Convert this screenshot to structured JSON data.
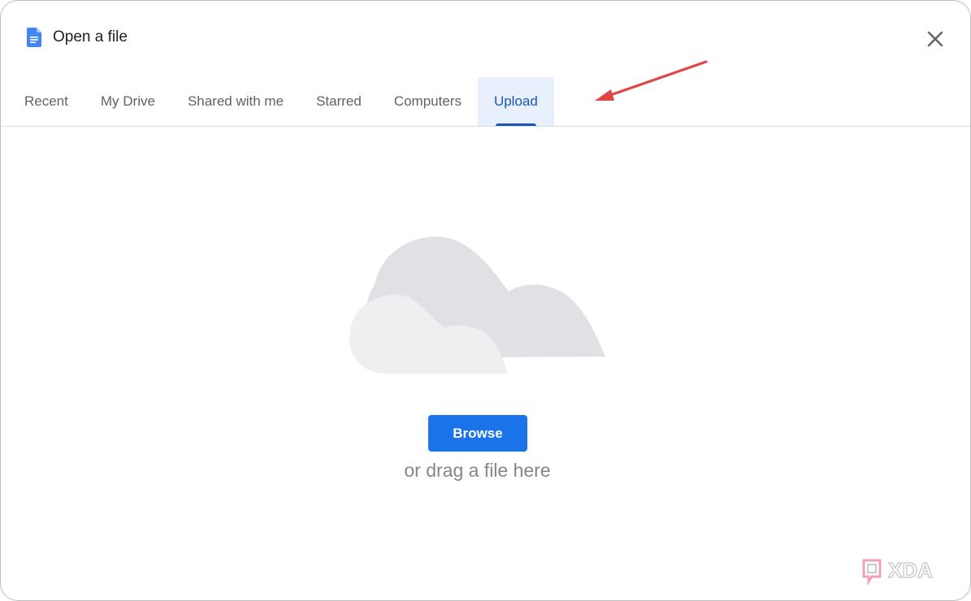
{
  "dialog": {
    "title": "Open a file",
    "title_icon": "docs-file-icon",
    "close_icon": "close-icon"
  },
  "tabs": [
    {
      "label": "Recent",
      "active": false
    },
    {
      "label": "My Drive",
      "active": false
    },
    {
      "label": "Shared with me",
      "active": false
    },
    {
      "label": "Starred",
      "active": false
    },
    {
      "label": "Computers",
      "active": false
    },
    {
      "label": "Upload",
      "active": true
    }
  ],
  "upload": {
    "illustration": "cloud-illustration",
    "browse_label": "Browse",
    "drag_text": "or drag a file here"
  },
  "annotation": {
    "icon": "red-arrow-icon",
    "color": "#e04646"
  },
  "watermark": {
    "text": "XDA",
    "icon": "xda-logo-icon"
  },
  "colors": {
    "accent": "#1a73e8",
    "active_tab_text": "#1a56b8",
    "active_tab_bg": "#e8f0fe"
  }
}
